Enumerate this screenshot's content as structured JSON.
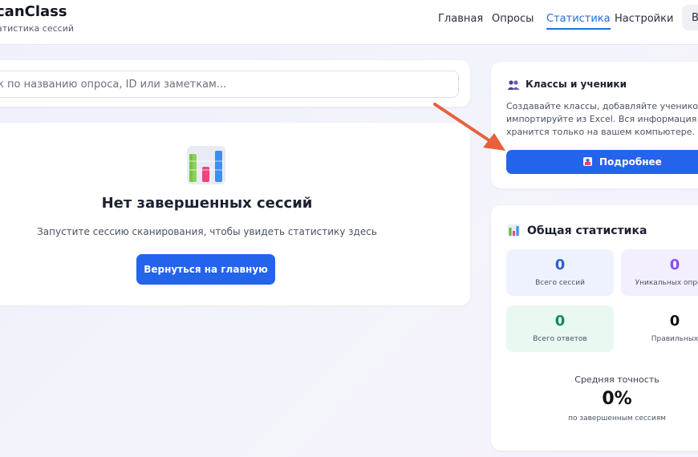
{
  "header": {
    "brand": "canClass",
    "subtitle": "атистика сессий",
    "nav": [
      "Главная",
      "Опросы",
      "Статистика",
      "Настройки"
    ],
    "active_nav": "Статистика",
    "nav_extra": "В"
  },
  "search": {
    "placeholder": "к по названию опроса, ID или заметкам...",
    "value": ""
  },
  "empty_state": {
    "icon": "bar-chart-icon",
    "title": "Нет завершенных сессий",
    "text": "Запустите сессию сканирования, чтобы увидеть статистику здесь",
    "button": "Вернуться на главную"
  },
  "classes": {
    "icon": "people-icon",
    "title": "Классы и ученики",
    "desc_lines": [
      "Создавайте классы, добавляйте учеников,",
      "импортируйте из Excel. Вся информация о ФИО",
      "хранится только на вашем компьютере."
    ],
    "button_icon": "students-icon",
    "button": "Подробнее"
  },
  "stats": {
    "icon": "bar-chart-icon",
    "title": "Общая статистика",
    "boxes": [
      {
        "value": "0",
        "label": "Всего сессий"
      },
      {
        "value": "0",
        "label": "Уникальных опросов"
      },
      {
        "value": "0",
        "label": "Всего ответов"
      },
      {
        "value": "0",
        "label": "Правильных"
      }
    ],
    "accuracy_label": "Средняя точность",
    "accuracy_value": "0%",
    "accuracy_sub": "по завершенным сессиям"
  },
  "colors": {
    "accent": "#2463eb",
    "arrow": "#e8603c"
  }
}
